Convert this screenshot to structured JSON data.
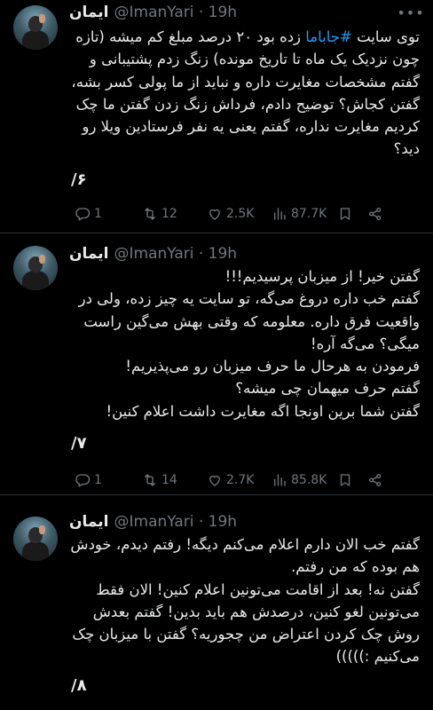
{
  "tweets": [
    {
      "name": "ایمان",
      "handle": "@ImanYari · 19h",
      "text_hashtag": "#جاباما",
      "text_pre": "توی سایت ",
      "text_post": " زده بود ۲۰ درصد مبلغ کم میشه (تازه چون نزدیک یک ماه تا تاریخ مونده) زنگ زدم پشتیبانی و گفتم مشخصات مغایرت داره و نباید از ما پولی کسر بشه، گفتن کجاش؟ توضیح دادم، فرداش زنگ زدن گفتن ما چک کردیم مغایرت نداره، گفتم یعنی یه نفر فرستادین ویلا رو دید؟",
      "number": "۶/",
      "replies": "1",
      "retweets": "12",
      "likes": "2.5K",
      "views": "87.7K"
    },
    {
      "name": "ایمان",
      "handle": "@ImanYari · 19h",
      "text": "گفتن خیر! از میزبان پرسیدیم!!!\nگفتم خب داره دروغ می‌گه، تو سایت یه چیز زده، ولی در واقعیت فرق داره. معلومه که وقتی بهش می‌گین راست میگی؟ می‌گه آره!\nفرمودن به هرحال ما حرف میزبان رو می‌پذیریم!\nگفتم حرف میهمان چی میشه؟\nگفتن شما برین اونجا اگه مغایرت داشت اعلام کنین!",
      "number": "۷/",
      "replies": "1",
      "retweets": "14",
      "likes": "2.7K",
      "views": "85.8K"
    },
    {
      "name": "ایمان",
      "handle": "@ImanYari · 19h",
      "text": "گفتم خب الان دارم اعلام می‌کنم دیگه! رفتم دیدم، خودش هم بوده که من رفتم.\nگفتن نه! بعد از اقامت می‌تونین اعلام کنین! الان فقط می‌تونین لغو کنین، درصدش هم باید بدین! گفتم بعدش روش چک کردن اعتراض من چجوریه؟ گفتن با میزبان چک می‌کنیم :)))))",
      "number": "۸/"
    }
  ],
  "icons": {
    "reply": "reply-icon",
    "retweet": "retweet-icon",
    "like": "heart-icon",
    "views": "views-icon",
    "bookmark": "bookmark-icon",
    "share": "share-icon",
    "more": "more-icon"
  }
}
